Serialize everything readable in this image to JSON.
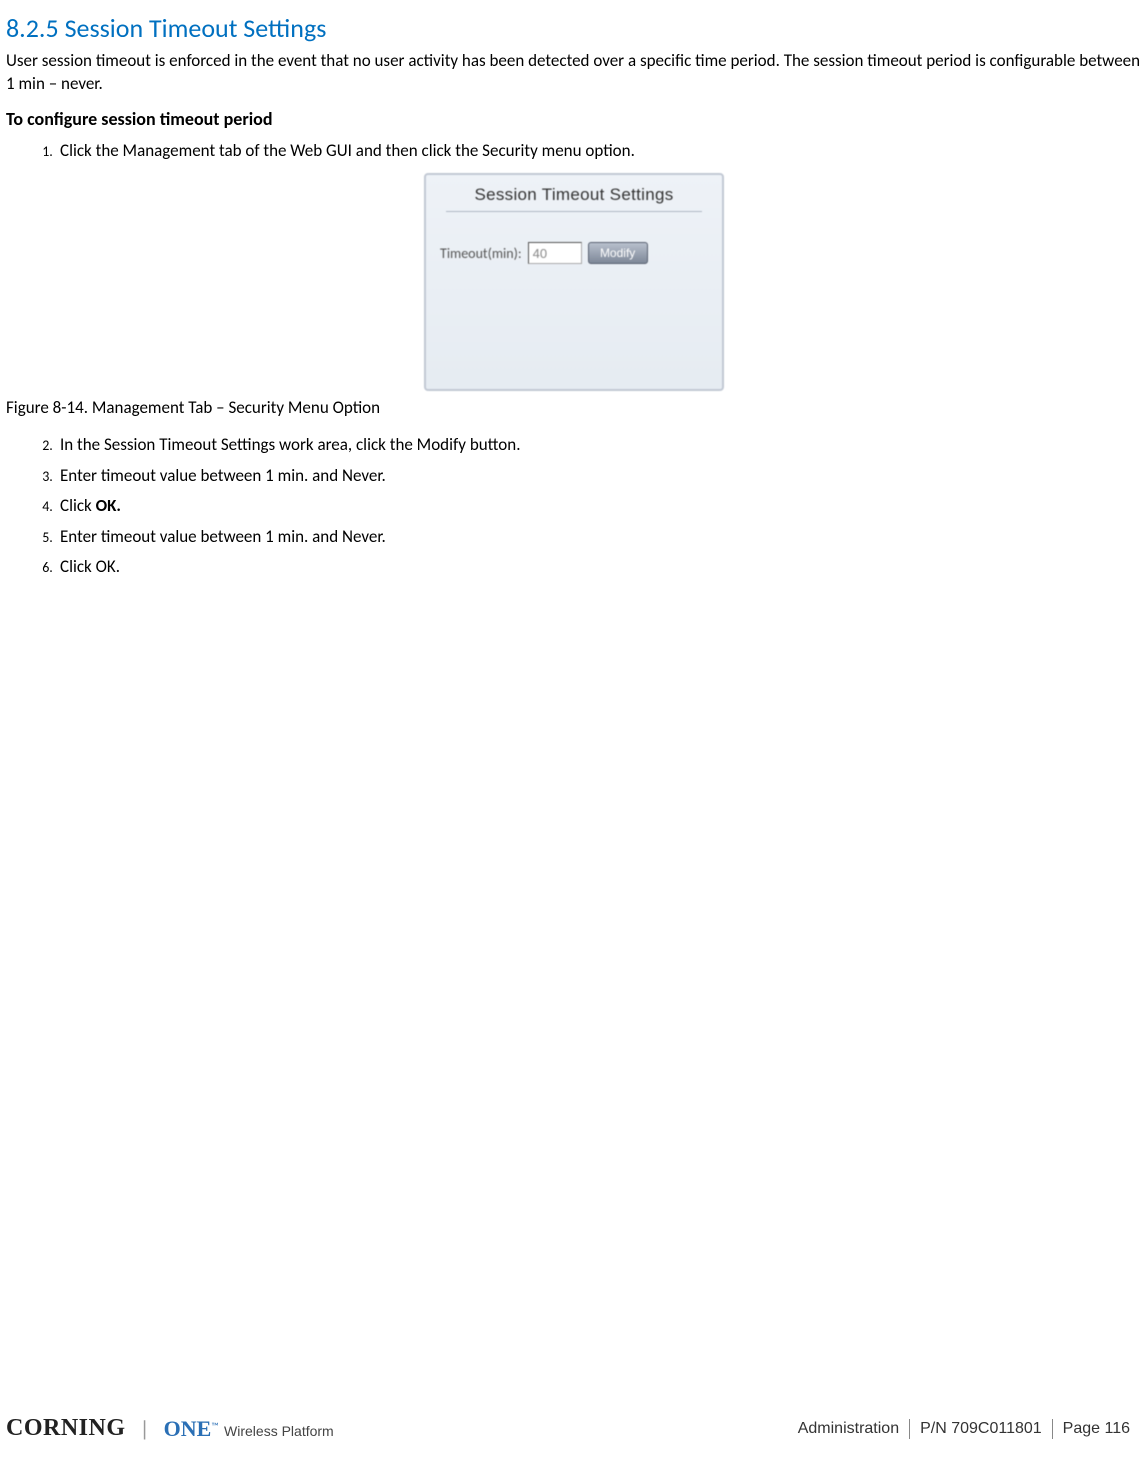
{
  "section": {
    "number": "8.2.5",
    "title": "Session Timeout Settings"
  },
  "paragraph1": "User session timeout is enforced in the event that no user activity has been detected over a specific time period. The session timeout period is configurable between 1 min – never.",
  "boldHeading": "To configure session timeout period",
  "steps_a": [
    "Click the Management tab of the Web GUI and then click the Security menu option."
  ],
  "gui": {
    "title": "Session Timeout Settings",
    "label": "Timeout(min):",
    "value": "40",
    "button": "Modify"
  },
  "figureCaption": "Figure 8-14. Management Tab – Security Menu Option",
  "steps_b": [
    "In the Session Timeout Settings work area, click the Modify button.",
    "Enter timeout value between 1 min. and Never.",
    "Click <b>OK.</b>",
    "Enter timeout value between 1 min. and Never.",
    "Click OK."
  ],
  "footer": {
    "brand1": "CORNING",
    "brand2a": "ONE",
    "brand2b": " Wireless Platform",
    "section": "Administration",
    "pn": "P/N 709C011801",
    "page": "Page 116"
  }
}
